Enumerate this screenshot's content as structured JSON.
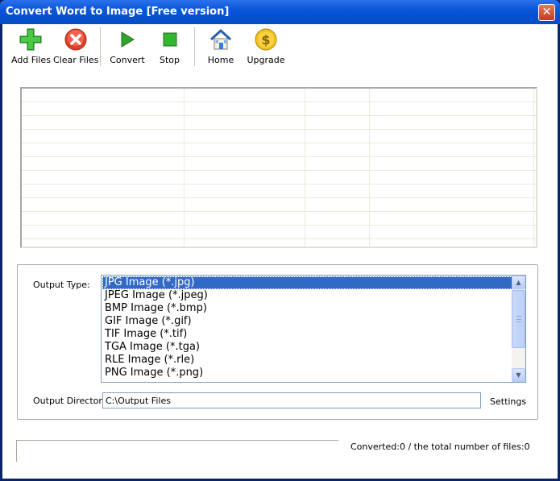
{
  "window": {
    "title": "Convert Word to Image [Free version]",
    "close_glyph": "✕"
  },
  "toolbar": {
    "add_files": "Add Files",
    "clear_files": "Clear Files",
    "convert": "Convert",
    "stop": "Stop",
    "home": "Home",
    "upgrade": "Upgrade"
  },
  "output": {
    "type_label": "Output Type:",
    "formats": [
      "JPG Image (*.jpg)",
      "JPEG Image (*.jpeg)",
      "BMP Image (*.bmp)",
      "GIF Image (*.gif)",
      "TIF Image (*.tif)",
      "TGA Image (*.tga)",
      "RLE Image (*.rle)",
      "PNG Image (*.png)"
    ],
    "selected_format": "JPG Image (*.jpg)",
    "directory_label": "Output Directory:",
    "directory_value": "C:\\Output Files",
    "settings_label": "Settings"
  },
  "status": {
    "text": "Converted:0  /  the total number of files:0"
  },
  "colors": {
    "titlebar": "#0a56d8",
    "selection": "#316ac5"
  }
}
